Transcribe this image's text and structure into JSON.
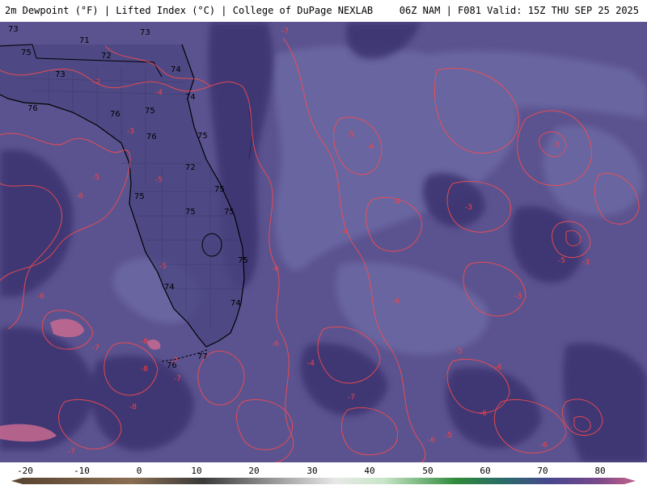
{
  "header": {
    "title_left": "2m Dewpoint (°F) | Lifted Index (°C) | College of DuPage NEXLAB",
    "title_right": "06Z NAM | F081 Valid: 15Z THU SEP 25 2025"
  },
  "map_labels": {
    "dewpoint": [
      "71",
      "73",
      "71",
      "73",
      "75",
      "72",
      "73",
      "74",
      "76",
      "76",
      "75",
      "74",
      "76",
      "75",
      "72",
      "75",
      "75",
      "75",
      "75",
      "75",
      "74",
      "74",
      "77",
      "76"
    ],
    "lifted_index": [
      "-7",
      "-2",
      "-4",
      "-3",
      "-5",
      "-5",
      "-6",
      "-5",
      "-4",
      "-5",
      "-4",
      "-3",
      "-4",
      "-5",
      "-3",
      "-6",
      "-6",
      "-6",
      "-6",
      "-7",
      "-8",
      "-7",
      "-8",
      "-7",
      "-8",
      "-7",
      "-6",
      "-5",
      "-5",
      "-6",
      "-6",
      "-7",
      "-5",
      "-6",
      "-4",
      "-3"
    ]
  },
  "colors": {
    "ocean_base": "#5b538f",
    "dark_moisture": "#3f3573",
    "light_moisture": "#6d6aa6",
    "contour": "#ff4a4a",
    "land_dark": "#4b4680",
    "coast": "#000000"
  },
  "legend": {
    "ticks": [
      "-20",
      "-10",
      "0",
      "10",
      "20",
      "30",
      "40",
      "50",
      "60",
      "70",
      "80"
    ]
  }
}
